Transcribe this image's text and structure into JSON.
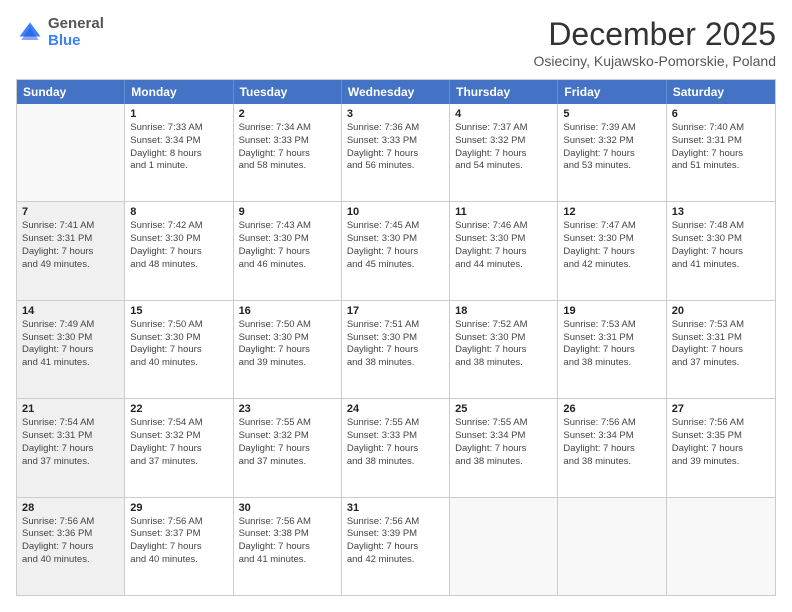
{
  "logo": {
    "general": "General",
    "blue": "Blue"
  },
  "header": {
    "month": "December 2025",
    "location": "Osieciny, Kujawsko-Pomorskie, Poland"
  },
  "days": [
    "Sunday",
    "Monday",
    "Tuesday",
    "Wednesday",
    "Thursday",
    "Friday",
    "Saturday"
  ],
  "weeks": [
    [
      {
        "day": "",
        "shaded": true,
        "lines": []
      },
      {
        "day": "1",
        "shaded": false,
        "lines": [
          "Sunrise: 7:33 AM",
          "Sunset: 3:34 PM",
          "Daylight: 8 hours",
          "and 1 minute."
        ]
      },
      {
        "day": "2",
        "shaded": false,
        "lines": [
          "Sunrise: 7:34 AM",
          "Sunset: 3:33 PM",
          "Daylight: 7 hours",
          "and 58 minutes."
        ]
      },
      {
        "day": "3",
        "shaded": false,
        "lines": [
          "Sunrise: 7:36 AM",
          "Sunset: 3:33 PM",
          "Daylight: 7 hours",
          "and 56 minutes."
        ]
      },
      {
        "day": "4",
        "shaded": false,
        "lines": [
          "Sunrise: 7:37 AM",
          "Sunset: 3:32 PM",
          "Daylight: 7 hours",
          "and 54 minutes."
        ]
      },
      {
        "day": "5",
        "shaded": false,
        "lines": [
          "Sunrise: 7:39 AM",
          "Sunset: 3:32 PM",
          "Daylight: 7 hours",
          "and 53 minutes."
        ]
      },
      {
        "day": "6",
        "shaded": false,
        "lines": [
          "Sunrise: 7:40 AM",
          "Sunset: 3:31 PM",
          "Daylight: 7 hours",
          "and 51 minutes."
        ]
      }
    ],
    [
      {
        "day": "7",
        "shaded": true,
        "lines": [
          "Sunrise: 7:41 AM",
          "Sunset: 3:31 PM",
          "Daylight: 7 hours",
          "and 49 minutes."
        ]
      },
      {
        "day": "8",
        "shaded": false,
        "lines": [
          "Sunrise: 7:42 AM",
          "Sunset: 3:30 PM",
          "Daylight: 7 hours",
          "and 48 minutes."
        ]
      },
      {
        "day": "9",
        "shaded": false,
        "lines": [
          "Sunrise: 7:43 AM",
          "Sunset: 3:30 PM",
          "Daylight: 7 hours",
          "and 46 minutes."
        ]
      },
      {
        "day": "10",
        "shaded": false,
        "lines": [
          "Sunrise: 7:45 AM",
          "Sunset: 3:30 PM",
          "Daylight: 7 hours",
          "and 45 minutes."
        ]
      },
      {
        "day": "11",
        "shaded": false,
        "lines": [
          "Sunrise: 7:46 AM",
          "Sunset: 3:30 PM",
          "Daylight: 7 hours",
          "and 44 minutes."
        ]
      },
      {
        "day": "12",
        "shaded": false,
        "lines": [
          "Sunrise: 7:47 AM",
          "Sunset: 3:30 PM",
          "Daylight: 7 hours",
          "and 42 minutes."
        ]
      },
      {
        "day": "13",
        "shaded": false,
        "lines": [
          "Sunrise: 7:48 AM",
          "Sunset: 3:30 PM",
          "Daylight: 7 hours",
          "and 41 minutes."
        ]
      }
    ],
    [
      {
        "day": "14",
        "shaded": true,
        "lines": [
          "Sunrise: 7:49 AM",
          "Sunset: 3:30 PM",
          "Daylight: 7 hours",
          "and 41 minutes."
        ]
      },
      {
        "day": "15",
        "shaded": false,
        "lines": [
          "Sunrise: 7:50 AM",
          "Sunset: 3:30 PM",
          "Daylight: 7 hours",
          "and 40 minutes."
        ]
      },
      {
        "day": "16",
        "shaded": false,
        "lines": [
          "Sunrise: 7:50 AM",
          "Sunset: 3:30 PM",
          "Daylight: 7 hours",
          "and 39 minutes."
        ]
      },
      {
        "day": "17",
        "shaded": false,
        "lines": [
          "Sunrise: 7:51 AM",
          "Sunset: 3:30 PM",
          "Daylight: 7 hours",
          "and 38 minutes."
        ]
      },
      {
        "day": "18",
        "shaded": false,
        "lines": [
          "Sunrise: 7:52 AM",
          "Sunset: 3:30 PM",
          "Daylight: 7 hours",
          "and 38 minutes."
        ]
      },
      {
        "day": "19",
        "shaded": false,
        "lines": [
          "Sunrise: 7:53 AM",
          "Sunset: 3:31 PM",
          "Daylight: 7 hours",
          "and 38 minutes."
        ]
      },
      {
        "day": "20",
        "shaded": false,
        "lines": [
          "Sunrise: 7:53 AM",
          "Sunset: 3:31 PM",
          "Daylight: 7 hours",
          "and 37 minutes."
        ]
      }
    ],
    [
      {
        "day": "21",
        "shaded": true,
        "lines": [
          "Sunrise: 7:54 AM",
          "Sunset: 3:31 PM",
          "Daylight: 7 hours",
          "and 37 minutes."
        ]
      },
      {
        "day": "22",
        "shaded": false,
        "lines": [
          "Sunrise: 7:54 AM",
          "Sunset: 3:32 PM",
          "Daylight: 7 hours",
          "and 37 minutes."
        ]
      },
      {
        "day": "23",
        "shaded": false,
        "lines": [
          "Sunrise: 7:55 AM",
          "Sunset: 3:32 PM",
          "Daylight: 7 hours",
          "and 37 minutes."
        ]
      },
      {
        "day": "24",
        "shaded": false,
        "lines": [
          "Sunrise: 7:55 AM",
          "Sunset: 3:33 PM",
          "Daylight: 7 hours",
          "and 38 minutes."
        ]
      },
      {
        "day": "25",
        "shaded": false,
        "lines": [
          "Sunrise: 7:55 AM",
          "Sunset: 3:34 PM",
          "Daylight: 7 hours",
          "and 38 minutes."
        ]
      },
      {
        "day": "26",
        "shaded": false,
        "lines": [
          "Sunrise: 7:56 AM",
          "Sunset: 3:34 PM",
          "Daylight: 7 hours",
          "and 38 minutes."
        ]
      },
      {
        "day": "27",
        "shaded": false,
        "lines": [
          "Sunrise: 7:56 AM",
          "Sunset: 3:35 PM",
          "Daylight: 7 hours",
          "and 39 minutes."
        ]
      }
    ],
    [
      {
        "day": "28",
        "shaded": true,
        "lines": [
          "Sunrise: 7:56 AM",
          "Sunset: 3:36 PM",
          "Daylight: 7 hours",
          "and 40 minutes."
        ]
      },
      {
        "day": "29",
        "shaded": false,
        "lines": [
          "Sunrise: 7:56 AM",
          "Sunset: 3:37 PM",
          "Daylight: 7 hours",
          "and 40 minutes."
        ]
      },
      {
        "day": "30",
        "shaded": false,
        "lines": [
          "Sunrise: 7:56 AM",
          "Sunset: 3:38 PM",
          "Daylight: 7 hours",
          "and 41 minutes."
        ]
      },
      {
        "day": "31",
        "shaded": false,
        "lines": [
          "Sunrise: 7:56 AM",
          "Sunset: 3:39 PM",
          "Daylight: 7 hours",
          "and 42 minutes."
        ]
      },
      {
        "day": "",
        "shaded": true,
        "lines": []
      },
      {
        "day": "",
        "shaded": true,
        "lines": []
      },
      {
        "day": "",
        "shaded": true,
        "lines": []
      }
    ]
  ]
}
